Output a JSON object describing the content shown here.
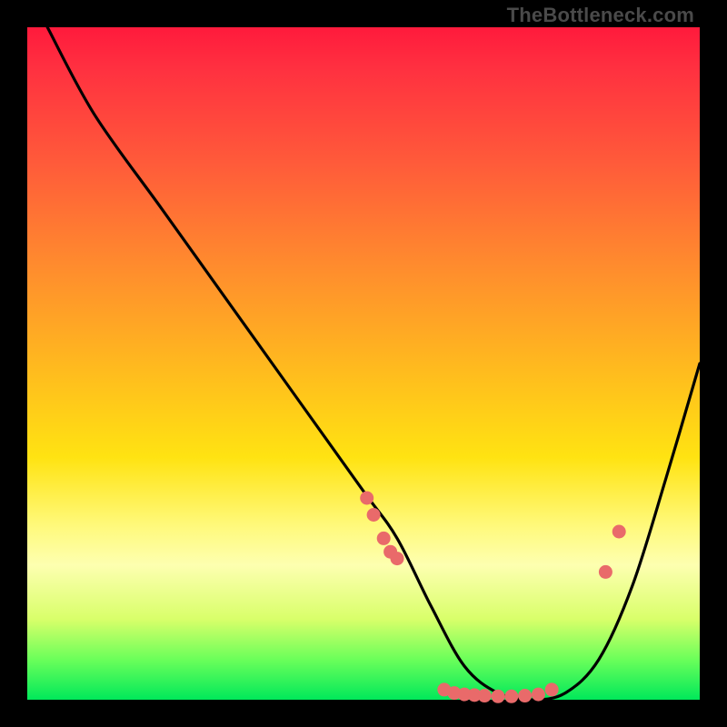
{
  "watermark": "TheBottleneck.com",
  "chart_data": {
    "type": "line",
    "title": "",
    "xlabel": "",
    "ylabel": "",
    "xlim": [
      0,
      100
    ],
    "ylim": [
      0,
      100
    ],
    "grid": false,
    "legend": false,
    "note": "No axis tick labels are visible in the image; values are percentage estimates read from relative pixel positions within the plot area.",
    "series": [
      {
        "name": "curve",
        "x": [
          3,
          10,
          20,
          30,
          40,
          50,
          55,
          60,
          65,
          70,
          75,
          80,
          85,
          90,
          95,
          100
        ],
        "y": [
          100,
          87,
          73,
          59,
          45,
          31,
          24,
          14,
          5,
          1,
          0,
          1,
          6,
          17,
          33,
          50
        ]
      }
    ],
    "markers": [
      {
        "x": 50.5,
        "y": 30
      },
      {
        "x": 51.5,
        "y": 27.5
      },
      {
        "x": 53,
        "y": 24
      },
      {
        "x": 54,
        "y": 22
      },
      {
        "x": 55,
        "y": 21
      },
      {
        "x": 62,
        "y": 1.5
      },
      {
        "x": 63.5,
        "y": 1
      },
      {
        "x": 65,
        "y": 0.8
      },
      {
        "x": 66.5,
        "y": 0.7
      },
      {
        "x": 68,
        "y": 0.6
      },
      {
        "x": 70,
        "y": 0.5
      },
      {
        "x": 72,
        "y": 0.5
      },
      {
        "x": 74,
        "y": 0.6
      },
      {
        "x": 76,
        "y": 0.8
      },
      {
        "x": 78,
        "y": 1.5
      },
      {
        "x": 86,
        "y": 19
      },
      {
        "x": 88,
        "y": 25
      }
    ],
    "colors": {
      "curve": "#000000",
      "markers": "#e96a6a",
      "gradient_top": "#ff1a3c",
      "gradient_mid": "#ffe312",
      "gradient_bottom": "#00e85a"
    }
  }
}
